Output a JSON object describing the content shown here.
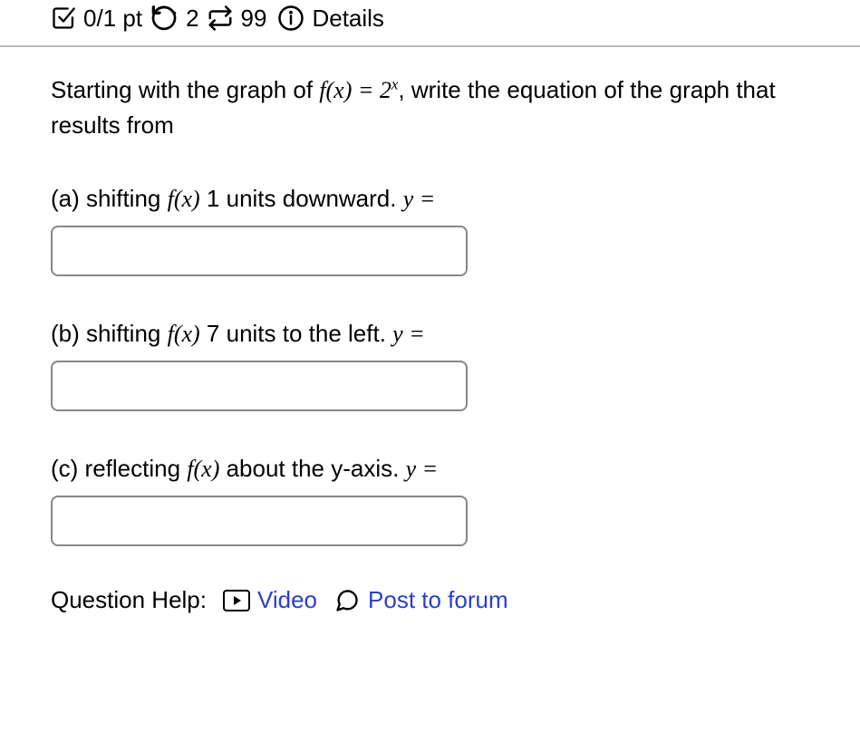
{
  "header": {
    "points": "0/1 pt",
    "attempts": "2",
    "tries": "99",
    "details": "Details"
  },
  "intro": {
    "before": "Starting with the graph of ",
    "func": "f(x) = 2",
    "exp": "x",
    "after": ", write the equation of the graph that results from"
  },
  "parts": {
    "a": {
      "label": "(a) shifting ",
      "func": "f(x)",
      "rest": " 1 units downward. ",
      "y": "y ="
    },
    "b": {
      "label": "(b) shifting ",
      "func": "f(x)",
      "rest": " 7 units to the left. ",
      "y": "y ="
    },
    "c": {
      "label": "(c) reflecting ",
      "func": "f(x)",
      "rest": " about the y-axis. ",
      "y": "y ="
    }
  },
  "help": {
    "label": "Question Help:",
    "video": "Video",
    "forum": "Post to forum"
  }
}
